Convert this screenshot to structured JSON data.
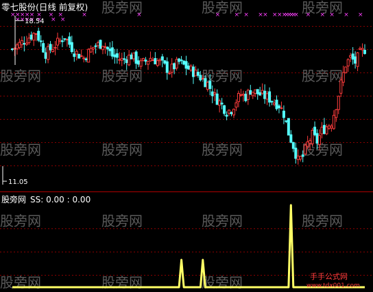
{
  "header": {
    "title": "零七股份(日线 前复权)",
    "price_high_label": "18.54",
    "price_low_label": "11.05"
  },
  "indicator": {
    "name": "股旁网",
    "formula": "SS: 0.00 : 0.00"
  },
  "watermark": {
    "text": "股旁网",
    "site_cn": "手手公式网",
    "site_url": "www.tdx001.com"
  },
  "colors": {
    "background": "#000000",
    "grid": "#8B0000",
    "divider": "#B00000",
    "up_candle": "#FF3C3C",
    "down_candle": "#54FFFF",
    "header_text": "#FFFFFF",
    "marker": "#FF40FF",
    "indicator_line": "#FFFF66",
    "watermark": "#5A5A5A"
  },
  "chart_data": [
    {
      "type": "candlestick",
      "title": "零七股份(日线 前复权)",
      "ylim": [
        11.05,
        18.54
      ],
      "grid": true,
      "annotations": [
        "18.54",
        "11.05"
      ],
      "close_path": [
        [
          0,
          17.2
        ],
        [
          5,
          17.6
        ],
        [
          10,
          18.0
        ],
        [
          14,
          17.0
        ],
        [
          18,
          17.4
        ],
        [
          22,
          17.8
        ],
        [
          26,
          17.1
        ],
        [
          30,
          16.8
        ],
        [
          34,
          17.3
        ],
        [
          38,
          17.5
        ],
        [
          42,
          16.9
        ],
        [
          46,
          16.7
        ],
        [
          50,
          16.9
        ],
        [
          54,
          16.5
        ],
        [
          58,
          16.8
        ],
        [
          62,
          16.6
        ],
        [
          66,
          16.2
        ],
        [
          70,
          16.6
        ],
        [
          74,
          16.3
        ],
        [
          78,
          16.0
        ],
        [
          82,
          15.6
        ],
        [
          85,
          15.0
        ],
        [
          88,
          14.6
        ],
        [
          90,
          14.3
        ],
        [
          92,
          14.4
        ],
        [
          94,
          14.8
        ],
        [
          96,
          15.1
        ],
        [
          98,
          15.0
        ],
        [
          100,
          15.3
        ],
        [
          104,
          15.1
        ],
        [
          108,
          14.9
        ],
        [
          112,
          14.6
        ],
        [
          114,
          14.2
        ],
        [
          116,
          13.3
        ],
        [
          118,
          12.7
        ],
        [
          120,
          12.0
        ],
        [
          122,
          12.2
        ],
        [
          124,
          12.8
        ],
        [
          126,
          13.2
        ],
        [
          128,
          12.9
        ],
        [
          130,
          13.4
        ],
        [
          134,
          13.8
        ],
        [
          136,
          14.6
        ],
        [
          138,
          15.6
        ],
        [
          140,
          16.5
        ],
        [
          142,
          16.8
        ],
        [
          144,
          16.6
        ],
        [
          146,
          17.0
        ],
        [
          148,
          17.2
        ]
      ],
      "marker_rows": [
        [
          0,
          2,
          4,
          6,
          8,
          11,
          16,
          20,
          30,
          53,
          86,
          94,
          98,
          104,
          106,
          110,
          112,
          114,
          115,
          116,
          117,
          118,
          119,
          124,
          130,
          134,
          140,
          146
        ],
        [
          2,
          4,
          6,
          8,
          11,
          17,
          21
        ]
      ]
    },
    {
      "type": "line",
      "series": [
        {
          "name": "SS",
          "points": [
            [
              0,
              0
            ],
            [
              70,
              0
            ],
            [
              71,
              1
            ],
            [
              72,
              0
            ],
            [
              79,
              0
            ],
            [
              80,
              1
            ],
            [
              81,
              0
            ],
            [
              116,
              0
            ],
            [
              117,
              3
            ],
            [
              118,
              0
            ],
            [
              148,
              0
            ]
          ]
        }
      ],
      "ylim": [
        0,
        3
      ]
    }
  ]
}
